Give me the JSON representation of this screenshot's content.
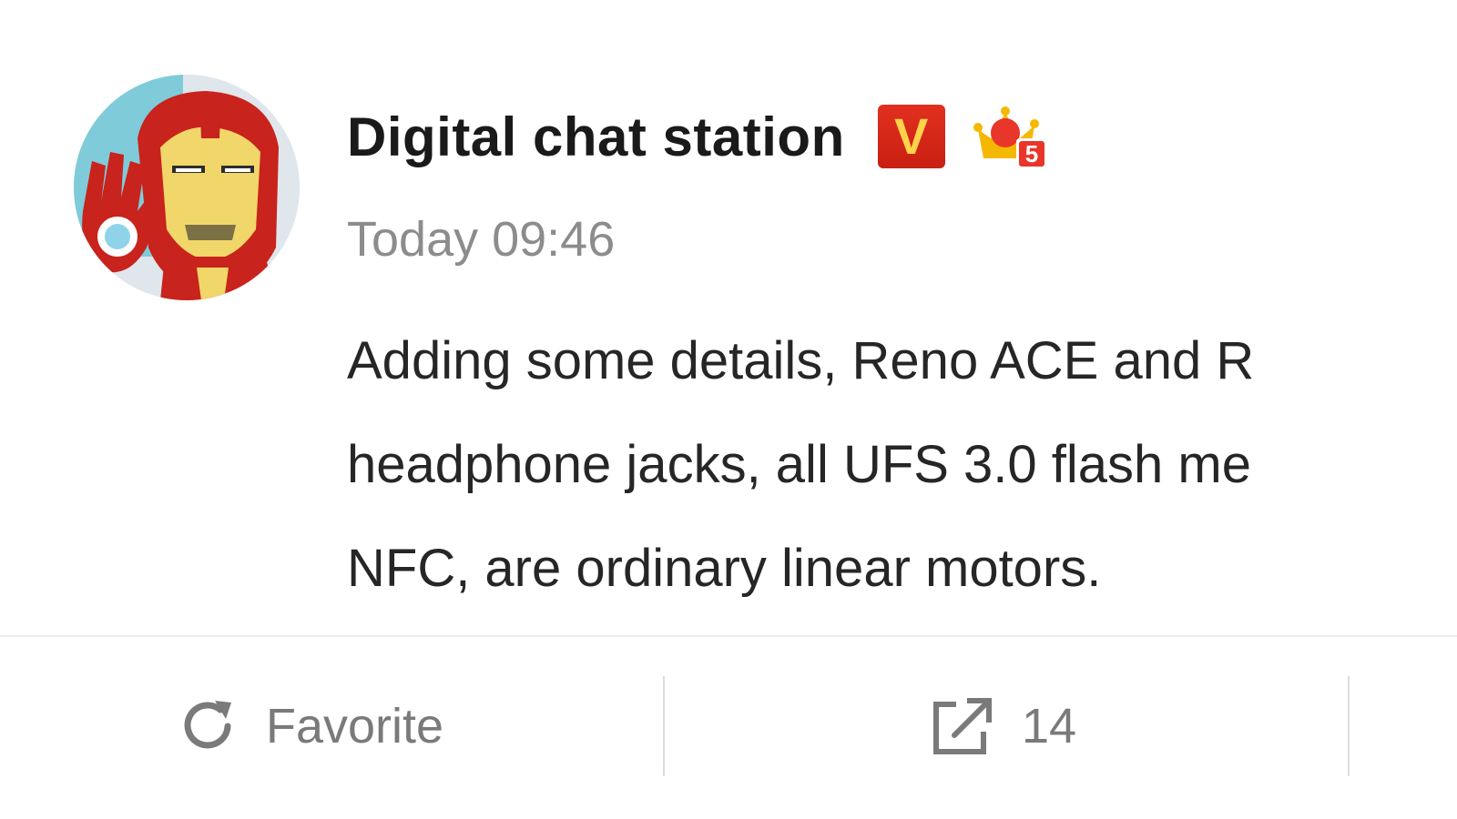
{
  "post": {
    "author": "Digital chat station",
    "verified_badge_letter": "V",
    "vip_badge_level": "5",
    "timestamp": "Today 09:46",
    "body_lines": [
      "Adding some details, Reno ACE and R",
      "headphone jacks, all UFS 3.0 flash me",
      "NFC, are ordinary linear motors."
    ]
  },
  "actions": {
    "favorite_label": "Favorite",
    "share_count": "14"
  },
  "icons": {
    "favorite": "refresh-arrow-icon",
    "share": "share-external-icon",
    "verified": "verified-v-badge-icon",
    "vip": "crown-badge-icon"
  },
  "colors": {
    "verified_badge": "#d7281a",
    "vip_crown": "#f5b800",
    "vip_tag": "#e8362b"
  }
}
